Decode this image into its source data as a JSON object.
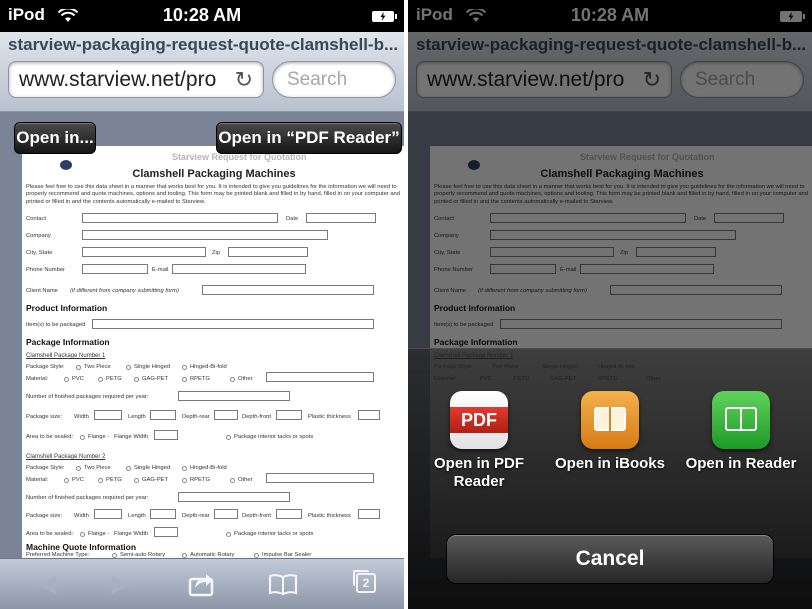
{
  "status_bar": {
    "carrier": "iPod",
    "time": "10:28 AM"
  },
  "browser": {
    "page_title": "starview-packaging-request-quote-clamshell-b...",
    "url": "www.starview.net/produ",
    "search_placeholder": "Search"
  },
  "overlay_buttons": {
    "open_in": "Open in...",
    "open_in_pdf_reader": "Open in “PDF Reader”"
  },
  "pdf": {
    "header_faded": "Starview Request for Quotation",
    "title": "Clamshell Packaging Machines",
    "intro": "Please feel free to use this data sheet in a manner that works best for you. It is intended to give you guidelines for the information we will need to properly recommend and quote machines, options and tooling. This form may be printed blank and filled in by hand, filled in on your computer and printed or filled in and the contents automatically e-mailed to Starview.",
    "fields": {
      "contact": "Contact",
      "date": "Date",
      "company": "Company",
      "city_state": "City, State",
      "zip": "Zip",
      "phone": "Phone Number",
      "email": "E-mail",
      "client_name": "Client Name",
      "client_name_note": "(if different from company submitting form)"
    },
    "product_info": "Product Information",
    "items_packaged": "Item(s) to be packaged",
    "package_info": "Package Information",
    "pkg1_title": "Clamshell Package Number 1",
    "pkg2_title": "Clamshell Package Number 2",
    "package_style": "Package Style:",
    "styles": [
      "Two Piece",
      "Single Hinged",
      "Hinged-Bi-fold"
    ],
    "material": "Material:",
    "materials": [
      "PVC",
      "PETG",
      "GAG-PET",
      "RPETG",
      "Other"
    ],
    "finished_packages": "Number of finished packages required per year:",
    "package_size": "Package size:",
    "sizes": [
      "Width",
      "Length",
      "Depth-rear",
      "Depth-front",
      "Plastic thickness"
    ],
    "area_sealed": "Area to be sealed:",
    "flange": "Flange -",
    "flange_width": "Flange Width",
    "interior_tacks": "Package interior tacks or spots",
    "machine_info": "Machine Quote Information",
    "preferred_machine": "Preferred Machine Type:",
    "machine_types": [
      "Semi-auto Rotary",
      "Automatic Rotary",
      "Impulse Bar Sealer"
    ]
  },
  "toolbar": {
    "tabs_count": "2"
  },
  "share_sheet": {
    "apps": [
      {
        "label": "Open in PDF Reader",
        "icon": "pdf-reader-icon",
        "icon_text": "PDF"
      },
      {
        "label": "Open in iBooks",
        "icon": "ibooks-icon"
      },
      {
        "label": "Open in Reader",
        "icon": "reader-icon"
      }
    ],
    "cancel": "Cancel"
  },
  "colors": {
    "status_bar": "#000000",
    "pdf_red": "#d0302a",
    "ibooks_orange": "#e99a2e",
    "reader_green": "#3bb53b"
  }
}
